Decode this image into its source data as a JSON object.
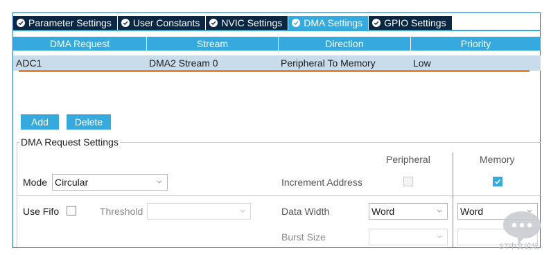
{
  "tabs": [
    {
      "label": "Parameter Settings",
      "active": false
    },
    {
      "label": "User Constants",
      "active": false
    },
    {
      "label": "NVIC Settings",
      "active": false
    },
    {
      "label": "DMA Settings",
      "active": true
    },
    {
      "label": "GPIO Settings",
      "active": false
    }
  ],
  "table": {
    "headers": [
      "DMA Request",
      "Stream",
      "Direction",
      "Priority"
    ],
    "rows": [
      {
        "request": "ADC1",
        "stream": "DMA2 Stream 0",
        "direction": "Peripheral To Memory",
        "priority": "Low"
      }
    ]
  },
  "buttons": {
    "add": "Add",
    "delete": "Delete"
  },
  "settings": {
    "title": "DMA Request Settings",
    "col_peripheral": "Peripheral",
    "col_memory": "Memory",
    "mode_label": "Mode",
    "mode_value": "Circular",
    "increment_label": "Increment Address",
    "increment_peripheral": false,
    "increment_memory": true,
    "use_fifo_label": "Use Fifo",
    "use_fifo": false,
    "threshold_label": "Threshold",
    "threshold_value": "",
    "data_width_label": "Data Width",
    "data_width_peripheral": "Word",
    "data_width_memory": "Word",
    "burst_size_label": "Burst Size",
    "burst_size_peripheral": "",
    "burst_size_memory": ""
  },
  "watermark": {
    "text": "ST中文论坛"
  },
  "colors": {
    "tab_bar": "#0a2744",
    "accent": "#36a9df",
    "row_selected": "#c9dcec",
    "row_underline": "#e8822f"
  },
  "icons": {
    "tab_status": "check-circle-icon",
    "dropdown": "chevron-down-icon",
    "checkbox_checked": "checkmark-icon",
    "watermark": "chat-bubble-icon"
  }
}
